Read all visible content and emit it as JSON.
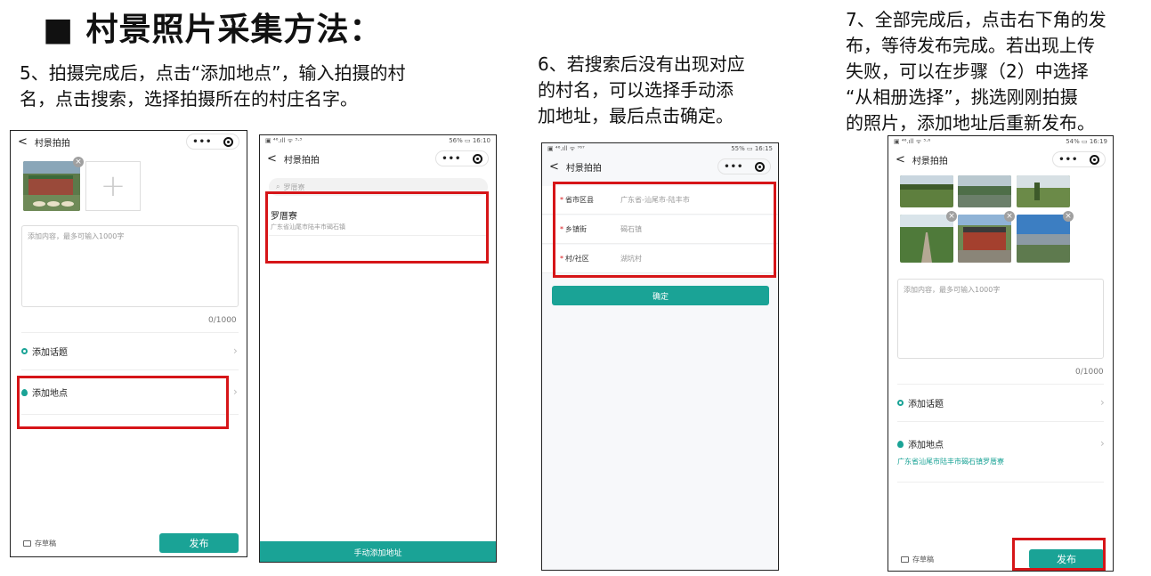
{
  "page": {
    "title": "■ 村景照片采集方法："
  },
  "steps": {
    "s5": "5、拍摄完成后，点击“添加地点”，输入拍摄的村\n名，点击搜索，选择拍摄所在的村庄名字。",
    "s6": "6、若搜索后没有出现对应\n的村名，可以选择手动添\n加地址，最后点击确定。",
    "s7": "7、全部完成后，点击右下角的发\n布，等待发布完成。若出现上传\n失败，可以在步骤（2）中选择\n“从相册选择”，挑选刚刚拍摄\n的照片，添加地址后重新发布。"
  },
  "app": {
    "nav_title": "村景拍拍",
    "back": "<",
    "capsule_dots": "•••"
  },
  "phone1": {
    "textarea_placeholder": "添加内容，最多可输入1000字",
    "counter": "0/1000",
    "topic": "添加话题",
    "location": "添加地点",
    "draft": "存草稿",
    "publish": "发布"
  },
  "phone2": {
    "status_left": "▣ ⁴⁶.ıll ᯤ ³·³",
    "status_right": "56% ▭ 16:10",
    "search_text": "罗厝寮",
    "result_name": "罗厝寮",
    "result_addr": "广东省汕尾市陆丰市碣石镇",
    "manual_btn": "手动添加地址"
  },
  "phone3": {
    "status_left": "▣ ⁴⁶.ıll ᯤ ⁷⁶⁷",
    "status_right": "55% ▭ 16:15",
    "rows": [
      {
        "label": "省市区县",
        "value": "广东省-汕尾市-陆丰市"
      },
      {
        "label": "乡镇街",
        "value": "碣石镇"
      },
      {
        "label": "村/社区",
        "value": "湖坑村"
      }
    ],
    "star": "*",
    "confirm": "确定"
  },
  "phone4": {
    "status_left": "▣ ⁴⁶.ıll ᯤ ⁵·⁶",
    "status_right": "54% ▭ 16:19",
    "textarea_placeholder": "添加内容，最多可输入1000字",
    "counter": "0/1000",
    "topic": "添加话题",
    "location": "添加地点",
    "location_value": "广东省汕尾市陆丰市碣石镇罗厝寮",
    "draft": "存草稿",
    "publish": "发布"
  },
  "icons": {
    "close": "×",
    "plus": "+",
    "chevron": "›",
    "search": "⌕"
  },
  "colors": {
    "accent": "#1aa396",
    "highlight": "#d61518"
  }
}
